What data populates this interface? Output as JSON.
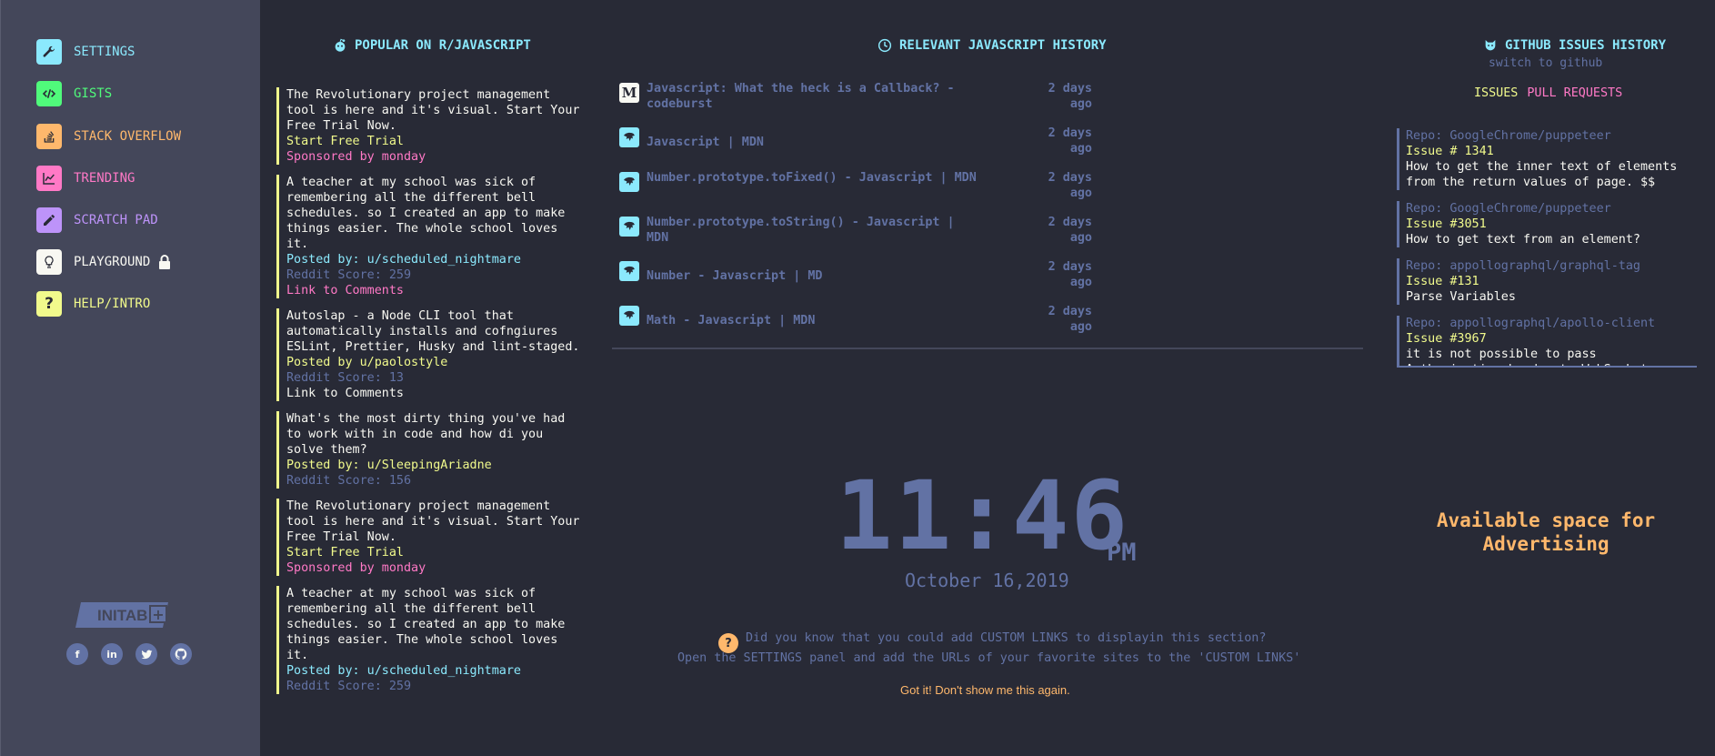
{
  "sidebar": {
    "items": [
      {
        "label": "SETTINGS",
        "icon": "wrench-icon",
        "color": "#8be9fd"
      },
      {
        "label": "GISTS",
        "icon": "code-icon",
        "color": "#50fa7b"
      },
      {
        "label": "STACK OVERFLOW",
        "icon": "stackoverflow-icon",
        "color": "#ffb86c"
      },
      {
        "label": "TRENDING",
        "icon": "chart-icon",
        "color": "#ff79c6"
      },
      {
        "label": "SCRATCH PAD",
        "icon": "pencil-icon",
        "color": "#bd93f9"
      },
      {
        "label": "PLAYGROUND",
        "icon": "lightbulb-icon",
        "color": "#f8f8f2"
      },
      {
        "label": "HELP/INTRO",
        "icon": "question-icon",
        "color": "#f1fa8c"
      }
    ],
    "logo_text": "INITAB",
    "socials": [
      "f",
      "in",
      "t",
      "gh"
    ]
  },
  "reddit": {
    "title": "POPULAR ON R/JAVASCRIPT",
    "posts": [
      {
        "text": "The Revolutionary project management tool is here and it's visual. Start Your Free Trial Now.",
        "lines": [
          {
            "t": "Start Free Trial",
            "c": "yellow"
          },
          {
            "t": "Sponsored by monday",
            "c": "pink"
          }
        ]
      },
      {
        "text": "A teacher at my school was sick of remembering all the different bell schedules. so I created an app to make things easier. The whole school loves it.",
        "lines": [
          {
            "t": "Posted by: u/scheduled_nightmare",
            "c": "cyan"
          },
          {
            "t": "Reddit Score: 259",
            "c": "muted"
          },
          {
            "t": "Link to Comments",
            "c": "pink"
          }
        ]
      },
      {
        "text": "Autoslap - a Node CLI tool that automatically installs and cofngiures ESLint, Prettier, Husky and lint-staged.",
        "lines": [
          {
            "t": "Posted by u/paolostyle",
            "c": "yellow"
          },
          {
            "t": "Reddit Score: 13",
            "c": "muted"
          },
          {
            "t": "Link to Comments",
            "c": "white"
          }
        ]
      },
      {
        "text": "What's the most dirty thing you've had to work with in code and how di you solve them?",
        "lines": [
          {
            "t": "Posted by: u/SleepingAriadne",
            "c": "yellow"
          },
          {
            "t": "Reddit Score: 156",
            "c": "muted"
          }
        ]
      },
      {
        "text": "The Revolutionary project management tool is here and it's visual. Start Your Free Trial Now.",
        "lines": [
          {
            "t": "Start Free Trial",
            "c": "yellow"
          },
          {
            "t": "Sponsored by monday",
            "c": "pink"
          }
        ]
      },
      {
        "text": "A teacher at my school was sick of remembering all the different bell schedules. so I created an app to make things easier. The whole school loves it.",
        "lines": [
          {
            "t": "Posted by: u/scheduled_nightmare",
            "c": "cyan"
          },
          {
            "t": "Reddit Score: 259",
            "c": "muted"
          }
        ]
      }
    ]
  },
  "history": {
    "title": "RELEVANT JAVASCRIPT HISTORY",
    "items": [
      {
        "title": "Javascript: What the heck is a Callback? - codeburst",
        "time": "2 days ago",
        "icon": "medium-icon"
      },
      {
        "title": "Javascript | MDN",
        "time": "2 days ago",
        "icon": "mdn-icon"
      },
      {
        "title": "Number.prototype.toFixed() - Javascript | MDN",
        "time": "2 days ago",
        "icon": "mdn-icon"
      },
      {
        "title": "Number.prototype.toString() - Javascript | MDN",
        "time": "2 days ago",
        "icon": "mdn-icon"
      },
      {
        "title": "Number - Javascript | MD",
        "time": "2 days ago",
        "icon": "mdn-icon"
      },
      {
        "title": "Math - Javascript | MDN",
        "time": "2 days ago",
        "icon": "mdn-icon"
      }
    ]
  },
  "clock": {
    "time": "11:46",
    "ampm": "PM",
    "date": "October 16,2019",
    "tip_line1": "Did you know that you could add CUSTOM LINKS to displayin this section?",
    "tip_line2": "Open the SETTINGS panel and add the URLs of your favorite sites to the 'CUSTOM LINKS'",
    "dismiss": "Got it! Don't show me this again."
  },
  "github": {
    "title": "GITHUB ISSUES HISTORY",
    "switch": "switch to github",
    "tab_issues": "ISSUES",
    "tab_prs": "PULL REQUESTS",
    "issues": [
      {
        "repo": "Repo: GoogleChrome/puppeteer",
        "num": "Issue # 1341",
        "title": "How to get the inner text of elements from the return values of page. $$"
      },
      {
        "repo": "Repo: GoogleChrome/puppeteer",
        "num": "Issue #3051",
        "title": "How to get text from an element?"
      },
      {
        "repo": "Repo: appollographql/graphql-tag",
        "num": "Issue #131",
        "title": "Parse Variables"
      },
      {
        "repo": "Repo: appollographql/apollo-client",
        "num": "Issue #3967",
        "title": "it is not possible to pass Authorization header to WebSocket"
      }
    ]
  },
  "ad": {
    "text": "Available space for Advertising"
  }
}
